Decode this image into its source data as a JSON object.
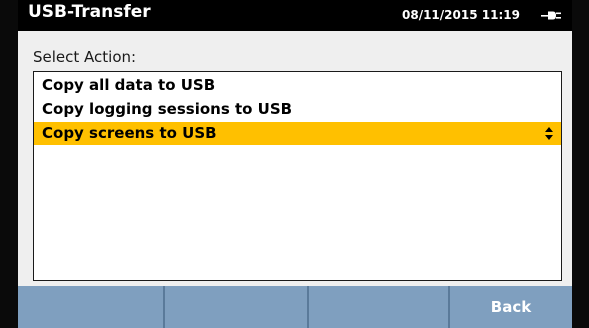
{
  "titlebar": {
    "title": "USB-Transfer",
    "datetime": "08/11/2015 11:19",
    "power_icon": "plug-icon"
  },
  "main": {
    "select_label": "Select Action:",
    "actions": [
      {
        "label": "Copy all data to USB",
        "selected": false
      },
      {
        "label": "Copy logging sessions to USB",
        "selected": false
      },
      {
        "label": "Copy screens to USB",
        "selected": true
      }
    ],
    "selector_icon": "up-down-arrows-icon"
  },
  "softkeys": [
    {
      "label": ""
    },
    {
      "label": ""
    },
    {
      "label": ""
    },
    {
      "label": "Back"
    }
  ],
  "colors": {
    "titlebar_bg": "#000000",
    "selection": "#ffc000",
    "softkey_bg": "#7f9fbf",
    "softkey_divider": "#5a7a9a"
  }
}
